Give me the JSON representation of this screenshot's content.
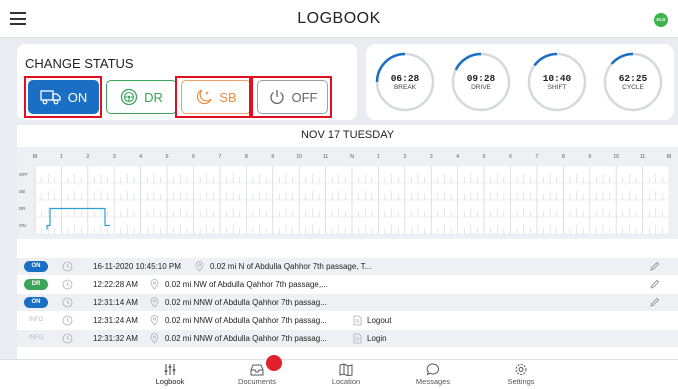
{
  "header": {
    "title": "LOGBOOK",
    "badge": "ELD"
  },
  "status": {
    "label": "CHANGE STATUS",
    "buttons": [
      {
        "label": "ON",
        "icon": "truck-icon"
      },
      {
        "label": "DR",
        "icon": "steering-wheel-icon"
      },
      {
        "label": "SB",
        "icon": "moon-stars-icon"
      },
      {
        "label": "OFF",
        "icon": "power-icon"
      }
    ]
  },
  "timers": [
    {
      "value": "06:28",
      "caption": "BREAK",
      "progress": 0.75
    },
    {
      "value": "09:28",
      "caption": "DRIVE",
      "progress": 0.82
    },
    {
      "value": "10:40",
      "caption": "SHIFT",
      "progress": 0.85
    },
    {
      "value": "62:25",
      "caption": "CYCLE",
      "progress": 0.86
    }
  ],
  "date_title": "NOV 17 TUESDAY",
  "graph": {
    "hours": [
      "M",
      "1",
      "2",
      "3",
      "4",
      "5",
      "6",
      "7",
      "8",
      "9",
      "10",
      "11",
      "N",
      "1",
      "2",
      "3",
      "4",
      "5",
      "6",
      "7",
      "8",
      "9",
      "10",
      "11",
      "M"
    ],
    "rows": [
      "OFF",
      "SB",
      "DR",
      "ON"
    ],
    "line_color": "#2a9fd6"
  },
  "logs": [
    {
      "status": "ON",
      "kind": "on",
      "time": "16-11-2020 10:45:10 PM",
      "location": "0.02 mi N of Abdulla Qahhor 7th passage, T...",
      "note": "",
      "editable": true
    },
    {
      "status": "DR",
      "kind": "dr",
      "time": "12:22:28 AM",
      "location": "0.02 mi NW of Abdulla Qahhor 7th passage,...",
      "note": "",
      "editable": true
    },
    {
      "status": "ON",
      "kind": "on",
      "time": "12:31:14 AM",
      "location": "0.02 mi NNW of Abdulla Qahhor 7th passag...",
      "note": "",
      "editable": true
    },
    {
      "status": "INFO",
      "kind": "info",
      "time": "12:31:24 AM",
      "location": "0.02 mi NNW of Abdulla Qahhor 7th passag...",
      "note": "Logout",
      "editable": false
    },
    {
      "status": "INFO",
      "kind": "info",
      "time": "12:31:32 AM",
      "location": "0.02 mi NNW of Abdulla Qahhor 7th passag...",
      "note": "Login",
      "editable": false
    }
  ],
  "nav": [
    {
      "label": "Logbook",
      "icon": "sliders-icon"
    },
    {
      "label": "Documents",
      "icon": "inbox-icon"
    },
    {
      "label": "Location",
      "icon": "map-icon"
    },
    {
      "label": "Messages",
      "icon": "chat-icon"
    },
    {
      "label": "Settings",
      "icon": "gear-icon"
    }
  ]
}
